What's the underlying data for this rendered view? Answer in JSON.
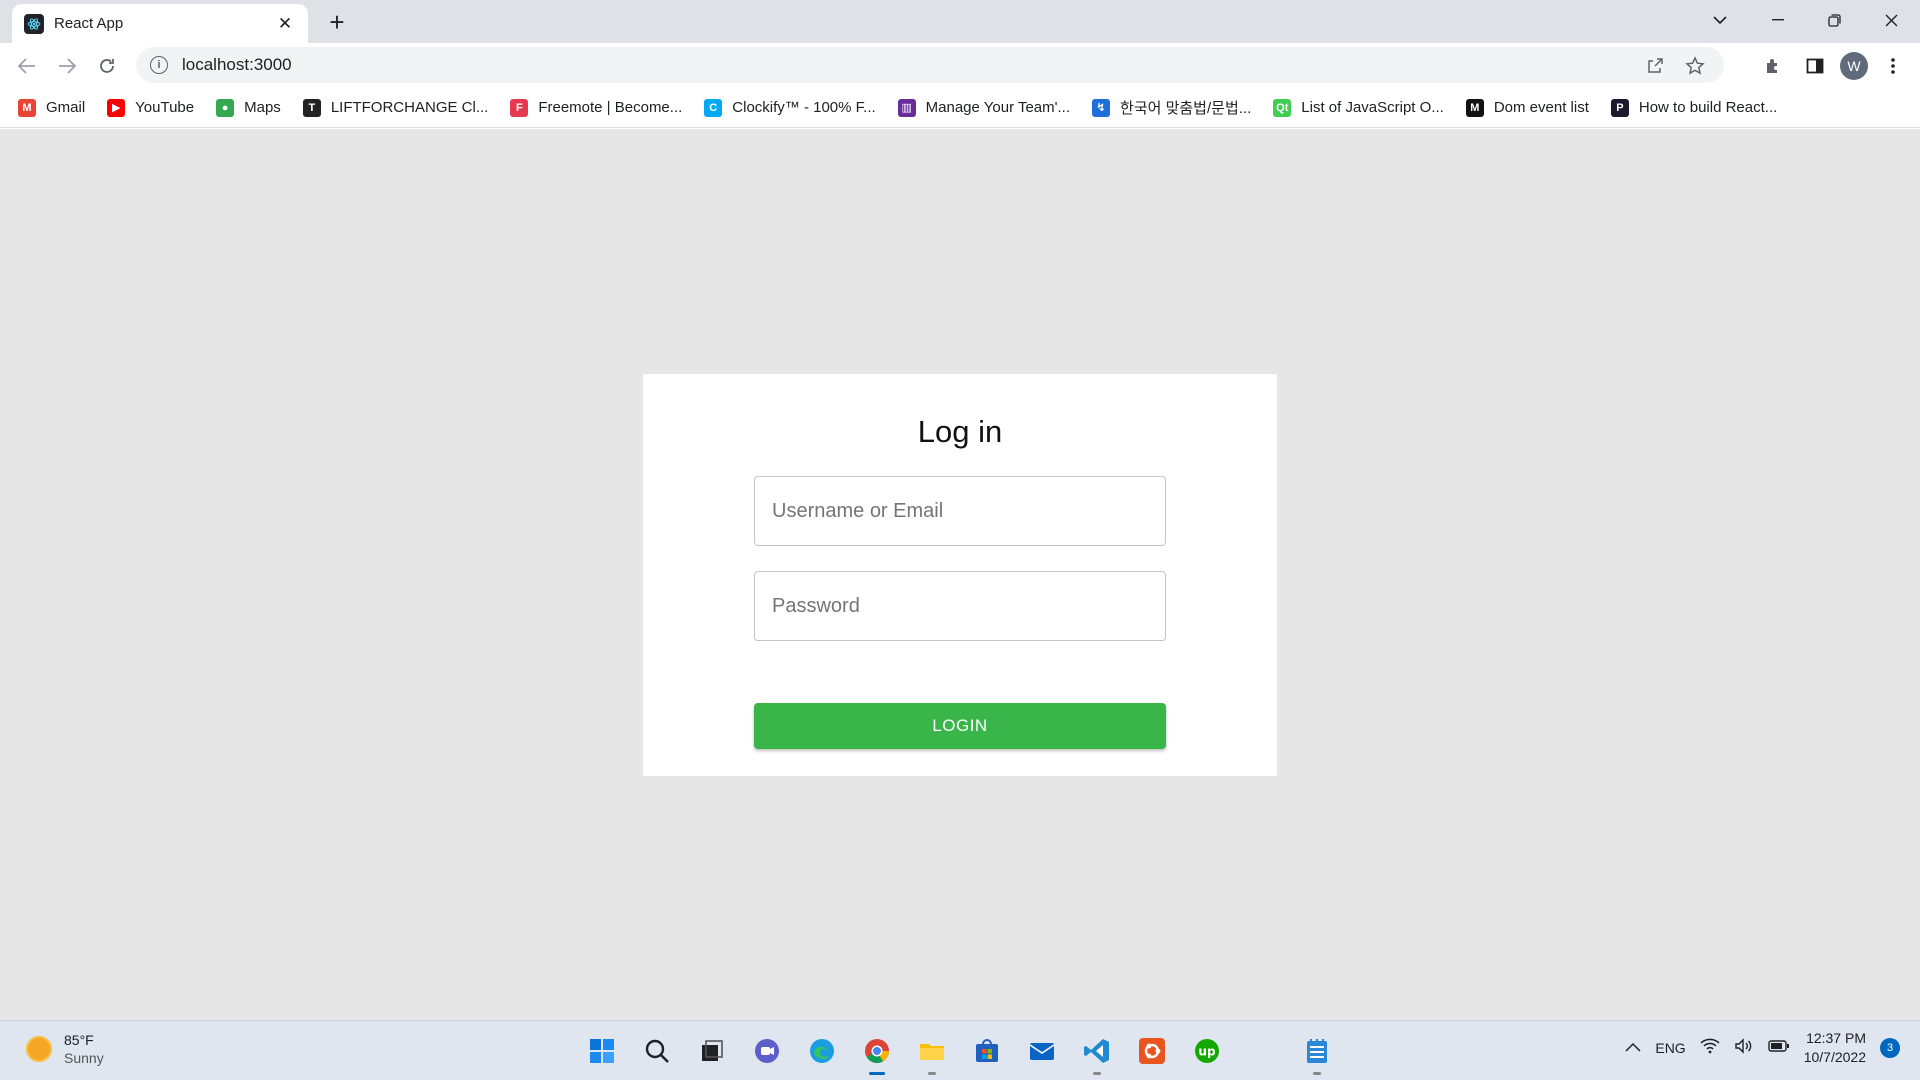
{
  "browser": {
    "tab_title": "React App",
    "url": "localhost:3000",
    "profile_initial": "W"
  },
  "bookmarks": [
    {
      "label": "Gmail",
      "icon": "gmail-icon",
      "color": "#ea4335",
      "glyph": "M"
    },
    {
      "label": "YouTube",
      "icon": "youtube-icon",
      "color": "#ff0000",
      "glyph": "▶"
    },
    {
      "label": "Maps",
      "icon": "maps-icon",
      "color": "#34a853",
      "glyph": "●"
    },
    {
      "label": "LIFTFORCHANGE Cl...",
      "icon": "liftforchange-icon",
      "color": "#222222",
      "glyph": "T"
    },
    {
      "label": "Freemote | Become...",
      "icon": "freemote-icon",
      "color": "#e53950",
      "glyph": "F"
    },
    {
      "label": "Clockify™ - 100% F...",
      "icon": "clockify-icon",
      "color": "#03a9f4",
      "glyph": "C"
    },
    {
      "label": "Manage Your Team'...",
      "icon": "trello-icon",
      "color": "#6a2c9a",
      "glyph": "▥"
    },
    {
      "label": "한국어 맞춤법/문법...",
      "icon": "korean-checker-icon",
      "color": "#1e6fd9",
      "glyph": "↯"
    },
    {
      "label": "List of JavaScript O...",
      "icon": "qt-icon",
      "color": "#41cd52",
      "glyph": "Qt"
    },
    {
      "label": "Dom event list",
      "icon": "medium-icon",
      "color": "#111111",
      "glyph": "M"
    },
    {
      "label": "How to build React...",
      "icon": "bookmark-site-icon",
      "color": "#1a1a2e",
      "glyph": "P"
    }
  ],
  "login": {
    "title": "Log in",
    "username_placeholder": "Username or Email",
    "password_placeholder": "Password",
    "button_label": "LOGIN",
    "accent_color": "#3ab54a"
  },
  "taskbar": {
    "temperature": "85°F",
    "condition": "Sunny",
    "language": "ENG",
    "time": "12:37 PM",
    "date": "10/7/2022",
    "notification_count": "3",
    "apps": [
      {
        "name": "start-icon",
        "color": "#0078d4"
      },
      {
        "name": "search-icon",
        "color": "#202124"
      },
      {
        "name": "task-view-icon",
        "color": "#202124"
      },
      {
        "name": "teams-chat-icon",
        "color": "#5b5fc7"
      },
      {
        "name": "edge-icon",
        "color": "#1b9de2"
      },
      {
        "name": "chrome-icon",
        "color": "#4285f4"
      },
      {
        "name": "file-explorer-icon",
        "color": "#f8c000"
      },
      {
        "name": "store-icon",
        "color": "#1f5fbf"
      },
      {
        "name": "mail-icon",
        "color": "#0a64c8"
      },
      {
        "name": "vscode-icon",
        "color": "#1f8ad2"
      },
      {
        "name": "ubuntu-icon",
        "color": "#e95420"
      },
      {
        "name": "upwork-icon",
        "color": "#14a800"
      },
      {
        "name": "notepad-icon",
        "color": "#2b88d8"
      }
    ]
  }
}
